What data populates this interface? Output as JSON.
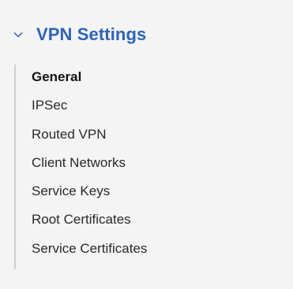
{
  "section": {
    "title": "VPN Settings",
    "expanded": true,
    "icon": "chevron-down-icon",
    "accent_color": "#2d63b8"
  },
  "items": [
    {
      "label": "General",
      "active": true
    },
    {
      "label": "IPSec",
      "active": false
    },
    {
      "label": "Routed VPN",
      "active": false
    },
    {
      "label": "Client Networks",
      "active": false
    },
    {
      "label": "Service Keys",
      "active": false
    },
    {
      "label": "Root Certificates",
      "active": false
    },
    {
      "label": "Service Certificates",
      "active": false
    }
  ]
}
